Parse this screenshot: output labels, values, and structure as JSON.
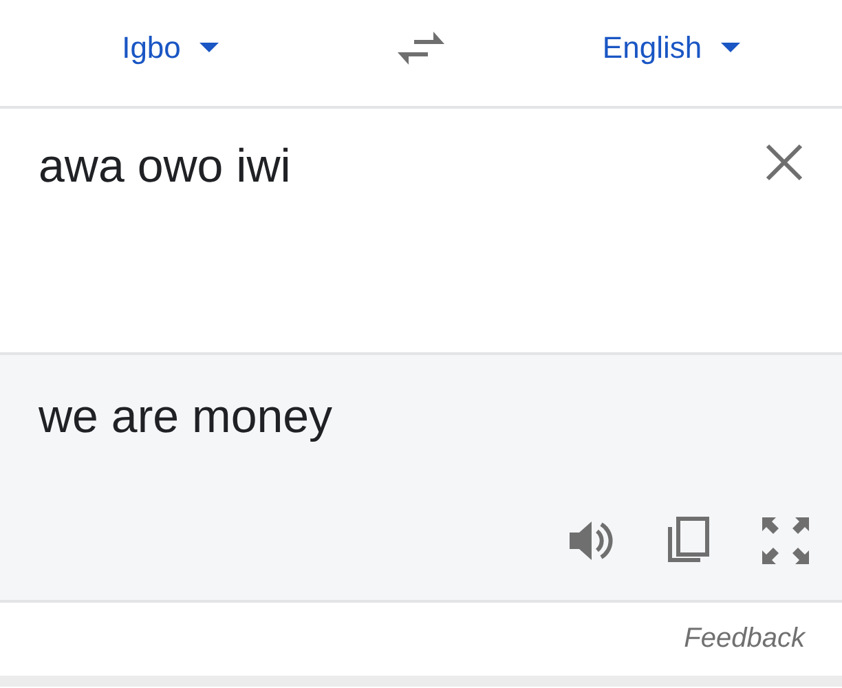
{
  "language_bar": {
    "source_language": "Igbo",
    "target_language": "English"
  },
  "source": {
    "value": "awa owo iwi"
  },
  "translation": {
    "text": "we are money"
  },
  "feedback": "Feedback"
}
